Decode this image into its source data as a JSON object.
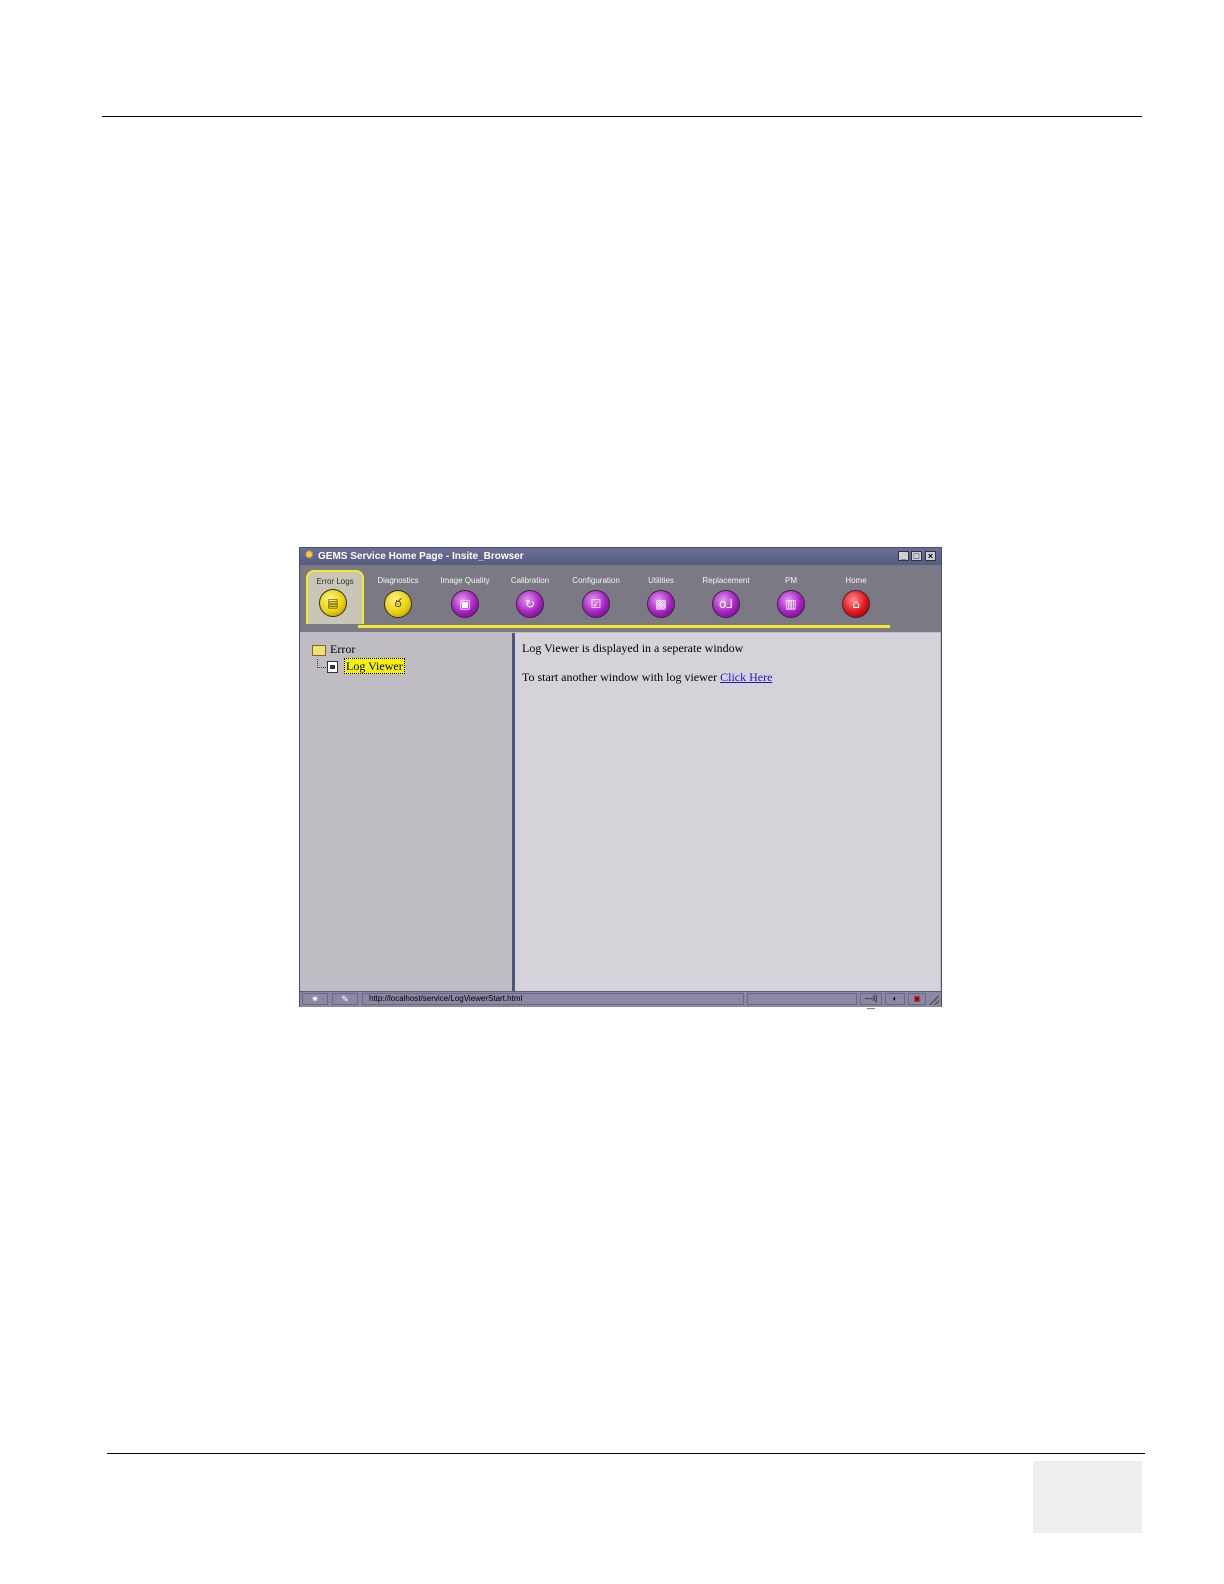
{
  "window": {
    "title": "GEMS Service Home Page - Insite_Browser",
    "controls": {
      "minimize": "_",
      "maximize": "□",
      "close": "×"
    }
  },
  "toolbar": {
    "tabs": [
      {
        "label": "Error Logs",
        "icon": "error-logs-icon",
        "color": "#e8d10a",
        "glyph": "▤"
      },
      {
        "label": "Diagnostics",
        "icon": "stethoscope-icon",
        "color": "#e8d10a",
        "glyph": "ఠ"
      },
      {
        "label": "Image Quality",
        "icon": "image-quality-icon",
        "color": "#a61fc2",
        "glyph": "▣"
      },
      {
        "label": "Calibration",
        "icon": "calibration-icon",
        "color": "#a61fc2",
        "glyph": "↻"
      },
      {
        "label": "Configuration",
        "icon": "configuration-icon",
        "color": "#a61fc2",
        "glyph": "☑"
      },
      {
        "label": "Utilities",
        "icon": "utilities-icon",
        "color": "#a61fc2",
        "glyph": "▩"
      },
      {
        "label": "Replacement",
        "icon": "replacement-icon",
        "color": "#a61fc2",
        "glyph": "o⅃"
      },
      {
        "label": "PM",
        "icon": "pm-icon",
        "color": "#a61fc2",
        "glyph": "▥"
      },
      {
        "label": "Home",
        "icon": "home-icon",
        "color": "#e1131b",
        "glyph": "⌂"
      }
    ],
    "selected": "Error Logs",
    "accent": "#f2ea2a"
  },
  "tree": {
    "root_label": "Error",
    "child_label": "Log Viewer"
  },
  "content": {
    "line1": "Log Viewer is displayed in a seperate window",
    "line2_prefix": "To start another window with log viewer ",
    "link_label": "Click Here"
  },
  "statusbar": {
    "url": "http://localhost/service/LogViewerStart.html",
    "icon_glyph_1": "✷",
    "icon_glyph_2": "✎",
    "icon_glyph_3": "—I|—",
    "icon_glyph_4": "◐",
    "icon_glyph_5": "▣"
  }
}
